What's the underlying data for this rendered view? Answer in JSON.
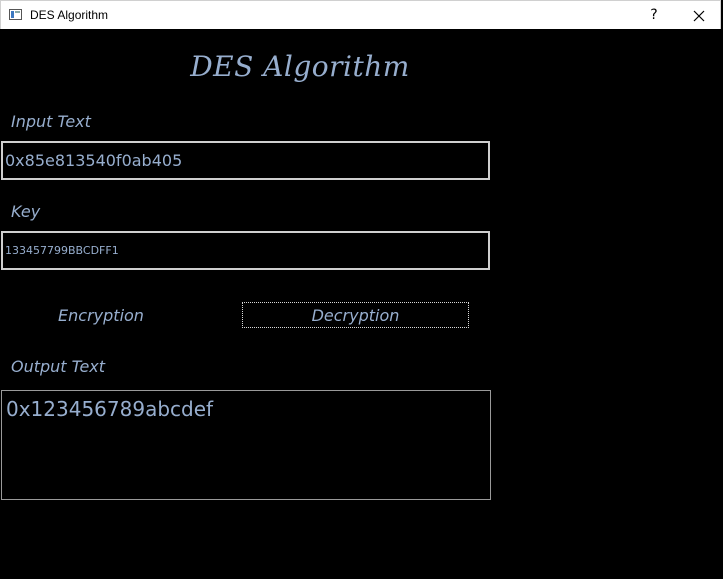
{
  "window": {
    "title": "DES Algorithm",
    "help_glyph": "?",
    "close_icon": "close-icon"
  },
  "heading": "DES Algorithm",
  "input": {
    "label": "Input Text",
    "value": "0x85e813540f0ab405"
  },
  "key": {
    "label": "Key",
    "value": "133457799BBCDFF1"
  },
  "buttons": {
    "encrypt_label": "Encryption",
    "decrypt_label": "Decryption"
  },
  "output": {
    "label": "Output Text",
    "value": "0x123456789abcdef"
  },
  "colors": {
    "background": "#000000",
    "text_accent": "#97aece",
    "titlebar": "#ffffff"
  }
}
